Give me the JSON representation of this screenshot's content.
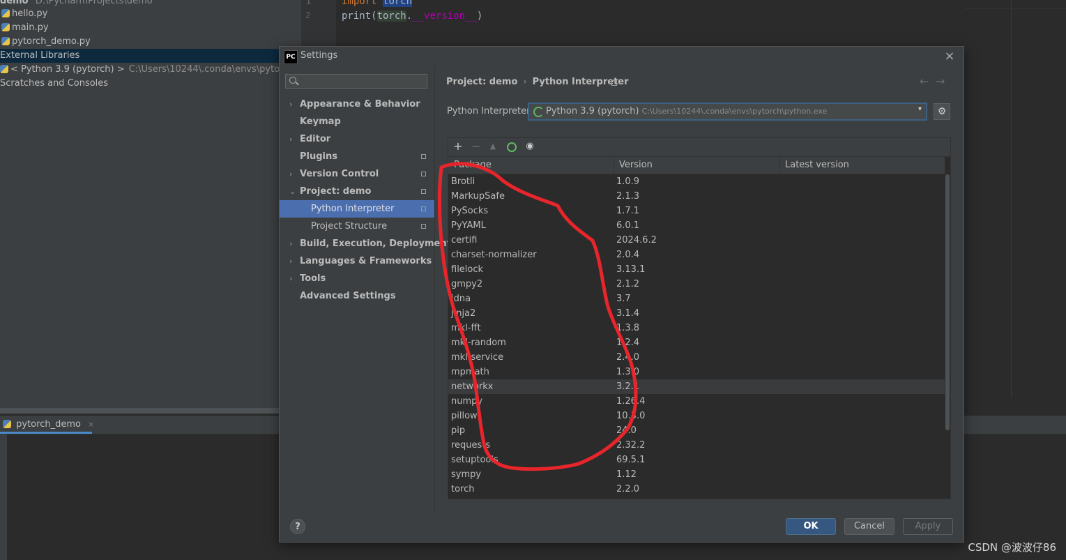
{
  "ide": {
    "project_tree": {
      "root_name": "demo",
      "root_path": "D:\\PycharmProjects\\demo",
      "files": [
        "hello.py",
        "main.py",
        "pytorch_demo.py"
      ],
      "external_libraries": "External Libraries",
      "interpreter_node": "< Python 3.9 (pytorch) >",
      "interpreter_path": "C:\\Users\\10244\\.conda\\envs\\pytorch\\pyt",
      "scratches": "Scratches and Consoles"
    },
    "editor": {
      "line_numbers": [
        "1",
        "2"
      ],
      "line1_kw": "import",
      "line1_mod": "torch",
      "line2_fn": "print(",
      "line2_obj": "torch",
      "line2_dot": ".",
      "line2_attr": "__version__",
      "line2_close": ")"
    },
    "run_tab": {
      "label": "pytorch_demo",
      "close": "×"
    }
  },
  "dialog": {
    "logo": "PC",
    "title": "Settings",
    "close": "×",
    "nav": {
      "items": [
        {
          "label": "Appearance & Behavior",
          "arrow": "›"
        },
        {
          "label": "Keymap",
          "arrow": ""
        },
        {
          "label": "Editor",
          "arrow": "›"
        },
        {
          "label": "Plugins",
          "arrow": ""
        },
        {
          "label": "Version Control",
          "arrow": "›"
        },
        {
          "label": "Project: demo",
          "arrow": "⌄"
        },
        {
          "label": "Python Interpreter",
          "arrow": ""
        },
        {
          "label": "Project Structure",
          "arrow": ""
        },
        {
          "label": "Build, Execution, Deployment",
          "arrow": "›"
        },
        {
          "label": "Languages & Frameworks",
          "arrow": "›"
        },
        {
          "label": "Tools",
          "arrow": "›"
        },
        {
          "label": "Advanced Settings",
          "arrow": ""
        }
      ]
    },
    "breadcrumb": {
      "parent": "Project: demo",
      "separator": "›",
      "current": "Python Interpreter"
    },
    "nav_back": "←",
    "nav_forward": "→",
    "interpreter": {
      "label": "Python Interpreter:",
      "name": "Python 3.9 (pytorch)",
      "path": "C:\\Users\\10244\\.conda\\envs\\pytorch\\python.exe",
      "dropdown_arrow": "▾",
      "gear": "⚙"
    },
    "toolbar": {
      "add": "+",
      "remove": "−",
      "up": "▲",
      "eye": "◉"
    },
    "table": {
      "headers": {
        "package": "Package",
        "version": "Version",
        "latest": "Latest version"
      },
      "rows": [
        {
          "name": "Brotli",
          "version": "1.0.9"
        },
        {
          "name": "MarkupSafe",
          "version": "2.1.3"
        },
        {
          "name": "PySocks",
          "version": "1.7.1"
        },
        {
          "name": "PyYAML",
          "version": "6.0.1"
        },
        {
          "name": "certifi",
          "version": "2024.6.2"
        },
        {
          "name": "charset-normalizer",
          "version": "2.0.4"
        },
        {
          "name": "filelock",
          "version": "3.13.1"
        },
        {
          "name": "gmpy2",
          "version": "2.1.2"
        },
        {
          "name": "idna",
          "version": "3.7"
        },
        {
          "name": "jinja2",
          "version": "3.1.4"
        },
        {
          "name": "mkl-fft",
          "version": "1.3.8"
        },
        {
          "name": "mkl-random",
          "version": "1.2.4"
        },
        {
          "name": "mkl-service",
          "version": "2.4.0"
        },
        {
          "name": "mpmath",
          "version": "1.3.0"
        },
        {
          "name": "networkx",
          "version": "3.2.1"
        },
        {
          "name": "numpy",
          "version": "1.26.4"
        },
        {
          "name": "pillow",
          "version": "10.3.0"
        },
        {
          "name": "pip",
          "version": "24.0"
        },
        {
          "name": "requests",
          "version": "2.32.2"
        },
        {
          "name": "setuptools",
          "version": "69.5.1"
        },
        {
          "name": "sympy",
          "version": "1.12"
        },
        {
          "name": "torch",
          "version": "2.2.0"
        }
      ],
      "highlighted_row": "networkx",
      "scroll_fraction_visible": 0.79
    },
    "footer": {
      "help": "?",
      "ok": "OK",
      "cancel": "Cancel",
      "apply": "Apply"
    }
  },
  "watermark": "CSDN @波波仔86",
  "colors": {
    "selection": "#4b6eaf",
    "ok_button": "#365880",
    "scribble": "#e8252b",
    "refresh_green": "#5fb85f"
  }
}
